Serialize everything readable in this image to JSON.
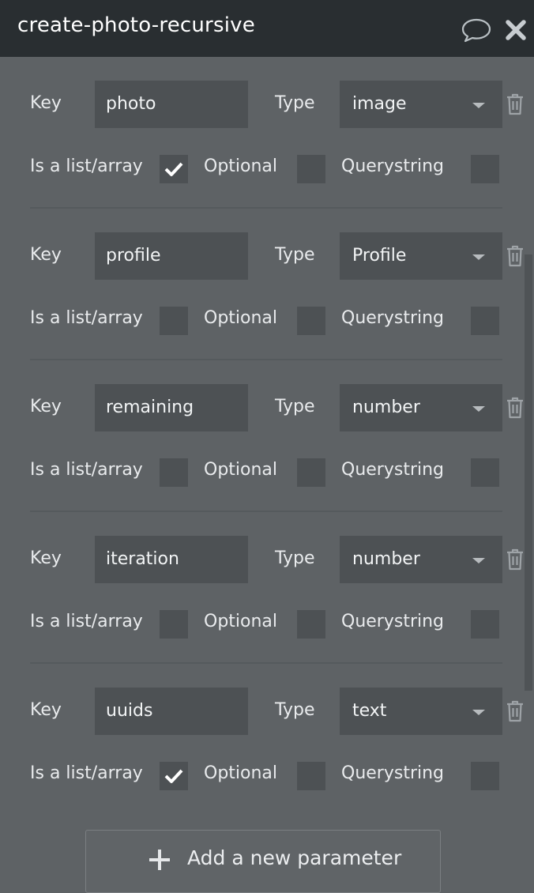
{
  "header": {
    "title": "create-photo-recursive",
    "comment_icon": "speech-bubble-icon",
    "close_icon": "close-x-icon"
  },
  "labels": {
    "key": "Key",
    "type": "Type",
    "is_list": "Is a list/array",
    "optional": "Optional",
    "querystring": "Querystring"
  },
  "parameters": [
    {
      "key": "photo",
      "type": "image",
      "is_list": true,
      "optional": false,
      "querystring": false
    },
    {
      "key": "profile",
      "type": "Profile",
      "is_list": false,
      "optional": false,
      "querystring": false
    },
    {
      "key": "remaining",
      "type": "number",
      "is_list": false,
      "optional": false,
      "querystring": false
    },
    {
      "key": "iteration",
      "type": "number",
      "is_list": false,
      "optional": false,
      "querystring": false
    },
    {
      "key": "uuids",
      "type": "text",
      "is_list": true,
      "optional": false,
      "querystring": false
    }
  ],
  "footer": {
    "add_button_label": "Add a new parameter",
    "add_icon": "plus-icon"
  },
  "colors": {
    "panel_bg": "#5e6265",
    "header_bg": "#292e31",
    "field_bg": "#4d5154"
  }
}
